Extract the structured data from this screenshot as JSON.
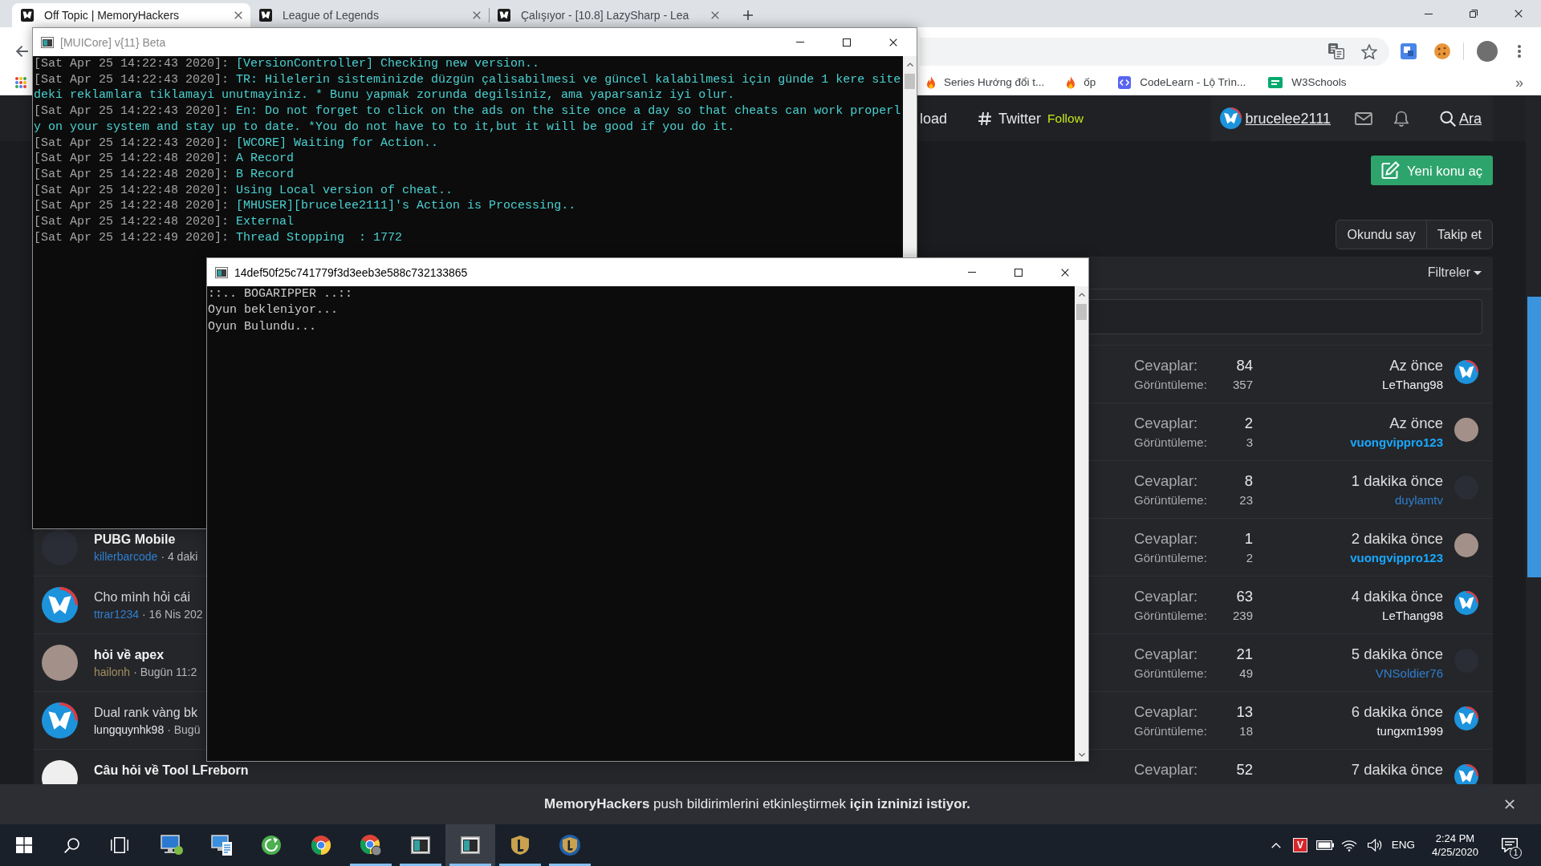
{
  "browser": {
    "tabs": [
      {
        "title": "Off Topic | MemoryHackers",
        "selected": true
      },
      {
        "title": "League of Legends",
        "selected": false
      },
      {
        "title": "Çalışıyor - [10.8] LazySharp - Lea",
        "selected": false
      }
    ],
    "bookmarks": [
      {
        "label": "Series Hướng đổi t...",
        "kind": "flame"
      },
      {
        "label": "ốp",
        "kind": "flame"
      },
      {
        "label": "CodeLearn - Lộ Trìn...",
        "kind": "code"
      },
      {
        "label": "W3Schools",
        "kind": "w3"
      }
    ],
    "bookmarks_overflow": "»"
  },
  "site": {
    "navbar": {
      "links": [
        {
          "label": "load",
          "kind": "plain"
        },
        {
          "label": "Twitter",
          "badge": "Follow",
          "kind": "hashtag"
        }
      ],
      "user": {
        "name": "brucelee2111",
        "avatar": {
          "kind": "logo"
        }
      },
      "search": "Ara"
    },
    "new_thread_button": "Yeni konu aç",
    "thread_actions": [
      "Okundu say",
      "Takip et"
    ],
    "filters_button": "Filtreler",
    "threads": [
      {
        "replies_label": "Cevaplar:",
        "replies": "84",
        "views_label": "Görüntüleme:",
        "views": "357",
        "latest": {
          "time": "Az önce",
          "user": "LeThang98",
          "color": "#f0f0f0",
          "bold": false,
          "avatar": {
            "kind": "logo"
          }
        }
      },
      {
        "replies_label": "Cevaplar:",
        "replies": "2",
        "views_label": "Görüntüleme:",
        "views": "3",
        "latest": {
          "time": "Az önce",
          "user": "vuongvippro123",
          "color": "#18a8ff",
          "bold": true,
          "avatar": {
            "kind": "photo"
          }
        }
      },
      {
        "replies_label": "Cevaplar:",
        "replies": "8",
        "views_label": "Görüntüleme:",
        "views": "23",
        "latest": {
          "time": "1 dakika önce",
          "user": "duylamtv",
          "color": "#2f7fcf",
          "bold": false,
          "avatar": {
            "kind": "dark"
          }
        }
      },
      {
        "avatar": {
          "kind": "dark"
        },
        "title": "PUBG Mobile",
        "unread": true,
        "author": {
          "name": "killerbarcode",
          "color": "#2f7fcf"
        },
        "meta": "· 4 daki",
        "replies_label": "Cevaplar:",
        "replies": "1",
        "views_label": "Görüntüleme:",
        "views": "2",
        "latest": {
          "time": "2 dakika önce",
          "user": "vuongvippro123",
          "color": "#18a8ff",
          "bold": true,
          "avatar": {
            "kind": "photo"
          }
        }
      },
      {
        "avatar": {
          "kind": "logo"
        },
        "title": "Cho mình hỏi cái",
        "unread": false,
        "author": {
          "name": "ttrar1234",
          "color": "#2f7fcf"
        },
        "meta": "· 16 Nis 202",
        "replies_label": "Cevaplar:",
        "replies": "63",
        "views_label": "Görüntüleme:",
        "views": "239",
        "latest": {
          "time": "4 dakika önce",
          "user": "LeThang98",
          "color": "#f0f0f0",
          "bold": false,
          "avatar": {
            "kind": "logo"
          }
        }
      },
      {
        "avatar": {
          "kind": "photo"
        },
        "title": "hỏi về apex",
        "unread": true,
        "author": {
          "name": "hailonh",
          "color": "#a38f5e"
        },
        "meta": "· Bugün 11:2",
        "replies_label": "Cevaplar:",
        "replies": "21",
        "views_label": "Görüntüleme:",
        "views": "49",
        "latest": {
          "time": "5 dakika önce",
          "user": "VNSoldier76",
          "color": "#2f7fcf",
          "bold": false,
          "avatar": {
            "kind": "dark"
          }
        }
      },
      {
        "avatar": {
          "kind": "logo"
        },
        "title": "Dual rank vàng bk",
        "unread": false,
        "author": {
          "name": "lungquynhk98",
          "color": "#e8e8e8"
        },
        "meta": "· Bugü",
        "replies_label": "Cevaplar:",
        "replies": "13",
        "views_label": "Görüntüleme:",
        "views": "18",
        "latest": {
          "time": "6 dakika önce",
          "user": "tungxm1999",
          "color": "#f0f0f0",
          "bold": false,
          "avatar": {
            "kind": "logo"
          }
        }
      },
      {
        "avatar": {
          "kind": "light"
        },
        "title": "Câu hỏi về Tool LFreborn",
        "unread": true,
        "replies_label": "Cevaplar:",
        "replies": "52",
        "latest": {
          "time": "7 dakika önce",
          "avatar": {
            "kind": "logo"
          }
        }
      }
    ]
  },
  "console_windows": [
    {
      "title": "[MUICore] v{11} Beta",
      "active": false,
      "lines": [
        {
          "stamp": "[Sat Apr 25 14:22:43 2020]:",
          "text": "[VersionController] Checking new version.."
        },
        {
          "stamp": "[Sat Apr 25 14:22:43 2020]:",
          "text": "TR: Hilelerin sisteminizde düzgün çalisabilmesi ve güncel kalabilmesi için günde 1 kere sitedeki reklamlara tiklamayi unutmayiniz. * Bunu yapmak zorunda degilsiniz, ama yaparsaniz iyi olur."
        },
        {
          "stamp": "[Sat Apr 25 14:22:43 2020]:",
          "text": "En: Do not forget to click on the ads on the site once a day so that cheats can work properly on your system and stay up to date. *You do not have to to it,but it will be good if you do it."
        },
        {
          "stamp": "[Sat Apr 25 14:22:43 2020]:",
          "text": "[WCORE] Waiting for Action.."
        },
        {
          "stamp": "[Sat Apr 25 14:22:48 2020]:",
          "text": "A Record"
        },
        {
          "stamp": "[Sat Apr 25 14:22:48 2020]:",
          "text": "B Record"
        },
        {
          "stamp": "[Sat Apr 25 14:22:48 2020]:",
          "text": "Using Local version of cheat.."
        },
        {
          "stamp": "[Sat Apr 25 14:22:48 2020]:",
          "text": "[MHUSER][brucelee2111]'s Action is Processing.."
        },
        {
          "stamp": "[Sat Apr 25 14:22:48 2020]:",
          "text": "External"
        },
        {
          "stamp": "[Sat Apr 25 14:22:49 2020]:",
          "text": "Thread Stopping  : 1772"
        }
      ]
    },
    {
      "title": "14def50f25c741779f3d3eeb3e588c732133865",
      "active": true,
      "lines": [
        {
          "text": "::.. BOGARIPPER ..::"
        },
        {
          "text": "Oyun bekleniyor..."
        },
        {
          "text": "Oyun Bulundu..."
        }
      ]
    }
  ],
  "notification": {
    "message": "**MemoryHackers** push bildirimlerini etkinleştirmek **için izninizi istiyor.**"
  },
  "taskbar": {
    "apps": [
      {
        "kind": "pc",
        "running": false,
        "selected": false
      },
      {
        "kind": "monitor",
        "running": false,
        "selected": false
      },
      {
        "kind": "green",
        "running": false,
        "selected": false
      },
      {
        "kind": "wheel",
        "running": false,
        "selected": false
      },
      {
        "kind": "wheel-profile",
        "running": true,
        "selected": false
      },
      {
        "kind": "console",
        "running": true,
        "selected": false
      },
      {
        "kind": "console",
        "running": true,
        "selected": true
      },
      {
        "kind": "emblem",
        "running": true,
        "selected": false
      },
      {
        "kind": "emblem-blue",
        "running": true,
        "selected": false
      }
    ],
    "tray_app": "V",
    "language": "ENG",
    "time": "2:24 PM",
    "date": "4/25/2020",
    "notification_count": "1"
  }
}
